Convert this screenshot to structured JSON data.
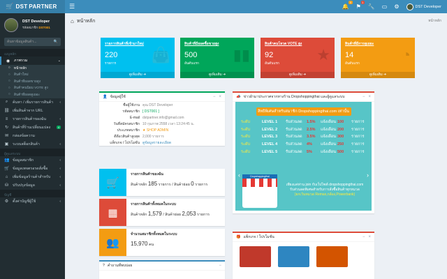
{
  "topbar": {
    "brand1": "DST",
    "brand2": "PARTNER",
    "notif_count": "0",
    "msg_count": "1",
    "username": "DST Developer"
  },
  "sidebar": {
    "username": "DST Developer",
    "member_label": "รหัสสมาชิก",
    "member_id": "DST001",
    "search_placeholder": "ค้นหาข้อมูลสินค้า...",
    "sec_menu": "เมนูหลัก",
    "overview": "ภาพรวม",
    "sub": [
      "หน้าหลัก",
      "สินค้าใหม่",
      "สินค้าที่ยอดขายสูง",
      "สินค้าคนนิยม VOTE สูง",
      "สินค้าที่ยอดดูเยอะ"
    ],
    "items": [
      "ค้นหา / เพิ่มรายการสินค้า",
      "เพิ่มสินค้าจาก URL",
      "รายการสินค้าของฉัน",
      "สินค้าที่ร้านเปลี่ยนแปลง",
      "กล่องข้อความ",
      "ระบบสต็อกสินค้า"
    ],
    "changed_badge": "4",
    "sec_user": "ผู้ดูแลระบบ",
    "items2": [
      "ข้อมูลสมาชิก",
      "ข้อมูลเพจตรอรดสั่งซื้อ",
      "เพิ่มข้อมูลร้านค้าสำหรับ",
      "ปรับปรุงข้อมูล"
    ],
    "sec_acct": "บัญชี",
    "items3": [
      "ตั้งค่าบัญชีผู้ใช้"
    ]
  },
  "page": {
    "title": "หน้าหลัก",
    "crumb": "หน้าหลัก"
  },
  "stats": [
    {
      "title": "รายการสินค้าที่เข้ามาใหม่",
      "value": "220",
      "unit": "รายการ",
      "foot": "ดูเพิ่มเติม",
      "color": "#00c0ef",
      "icon": "shopping-bag-icon"
    },
    {
      "title": "สินค้าที่มียอดซื้อขายสูง",
      "value": "500",
      "unit": "อันดับแรก",
      "foot": "ดูเพิ่มเติม",
      "color": "#00a65a",
      "icon": "bar-chart-icon"
    },
    {
      "title": "สินค้าคนโหวต VOTE สูง",
      "value": "92",
      "unit": "อันดับแรก",
      "foot": "ดูเพิ่มเติม",
      "color": "#dd4b39",
      "icon": "star-icon"
    },
    {
      "title": "สินค้าที่มีการดูเยอะ",
      "value": "14",
      "unit": "อันดับแรก",
      "foot": "ดูเพิ่มเติม",
      "color": "#f39c12",
      "icon": "pie-chart-icon"
    }
  ],
  "profile": {
    "header": "ข้อมูลผู้ใช้",
    "fields": [
      {
        "label": "ชื่อผู้ใช้งาน",
        "value": "คุณ DST Developer"
      },
      {
        "label": "รหัสสมาชิก",
        "value": "[ DST001 ]"
      },
      {
        "label": "E-mail",
        "value": "dstpartner.info@gmail.com"
      },
      {
        "label": "วันที่สมัครสมาชิก",
        "value": "10 กุมภาพ 2558 เวลา 13:24:45 น."
      },
      {
        "label": "ประเภทสมาชิก",
        "value": "SHOP ADMIN"
      },
      {
        "label": "ดีดีอวสินค้าสูงสุด",
        "value": "2,000 รายการ"
      },
      {
        "label": "แพ็กเกจ / โปรโมชั่น",
        "value": "ดูข้อมูลรายละเอียด"
      }
    ]
  },
  "info": [
    {
      "title": "รายการสินค้าของฉัน",
      "l1": "สินค้าหลัก",
      "v1": "185",
      "u1": "รายการ",
      "l2": "สินค้าย่อย",
      "v2": "0",
      "u2": "รายการ",
      "color": "#00c0ef",
      "icon": "cart-icon"
    },
    {
      "title": "รายการสินค้าทั้งหมดในระบบ",
      "l1": "สินค้าหลัก",
      "v1": "1,579",
      "u1": "/ สินค้าย่อย",
      "l2": "",
      "v2": "2,053",
      "u2": "รายการ",
      "color": "#dd4b39",
      "icon": "cubes-icon"
    },
    {
      "title": "จำนวนสมาชิกทั้งหมดในระบบ",
      "l1": "",
      "v1": "15,970",
      "u1": "คน",
      "l2": "",
      "v2": "",
      "u2": "",
      "color": "#f39c12",
      "icon": "users-icon"
    }
  ],
  "news": {
    "header": "ข่าวผ้ามาประกาศจากทางร้าน Dropshoppingthai และผู้ดูแลระบบ"
  },
  "banner": {
    "title": "สิทธิพิเศษสำหรับสมาชิก Dropshoppingthai.com เท่านั้น",
    "levels": [
      {
        "a": "ระดับ",
        "b": "LEVEL 1",
        "c": "รับส่วนลด",
        "d": "1.5%",
        "e": "แจ้งเดือน",
        "f": "100",
        "g": "รายการ"
      },
      {
        "a": "ระดับ",
        "b": "LEVEL 2",
        "c": "รับส่วนลด",
        "d": "2.5%",
        "e": "แจ้งเดือน",
        "f": "200",
        "g": "รายการ"
      },
      {
        "a": "ระดับ",
        "b": "LEVEL 3",
        "c": "รับส่วนลด",
        "d": "3.5%",
        "e": "แจ้งเดือน",
        "f": "300",
        "g": "รายการ"
      },
      {
        "a": "ระดับ",
        "b": "LEVEL 4",
        "c": "รับส่วนลด",
        "d": "4%",
        "e": "แจ้งเดือน",
        "f": "250",
        "g": "รายการ"
      },
      {
        "a": "ระดับ",
        "b": "LEVEL 5",
        "c": "รับส่วนลด",
        "d": "5%",
        "e": "แจ้งเดือน",
        "f": "500",
        "g": "รายการ"
      }
    ],
    "line1": "เพียงแค่ท่าน join กับเว็ปไซต์ dropshoppingthai.com",
    "line2": "รับส่วนลดพิเศษสำหรับการสั่งซื้อสินค้าทุกหมวด",
    "line3": "(ยกเว้นหมวด Remax,กล้อง,Powerbank)",
    "store_sign": "Dropshoppingthai"
  },
  "promo": {
    "header": "แพ็กเกจ / โปรโมชั่น"
  },
  "help": {
    "header": "คำถามที่พบบ่อย"
  }
}
